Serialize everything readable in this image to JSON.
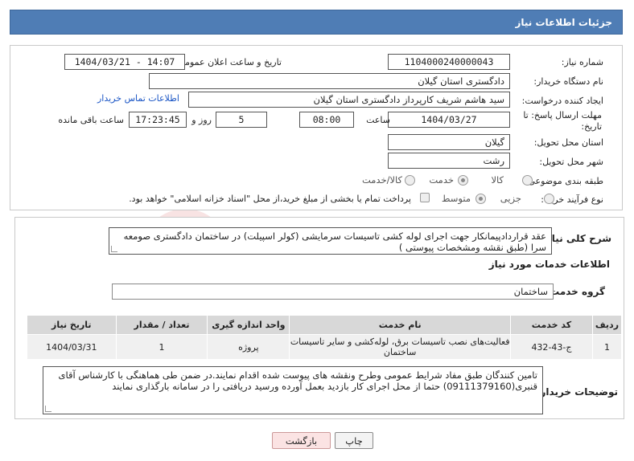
{
  "header": {
    "title": "جزئیات اطلاعات نیاز"
  },
  "form": {
    "need_number_label": "شماره نیاز:",
    "need_number": "1104000240000043",
    "announce_label": "تاریخ و ساعت اعلان عمومی:",
    "announce_value": "1404/03/21 - 14:07",
    "buyer_org_label": "نام دستگاه خریدار:",
    "buyer_org": "دادگستری استان گیلان",
    "requester_label": "ایجاد کننده درخواست:",
    "requester": "سید هاشم شریف کارپرداز دادگستری استان گیلان",
    "contact_link": "اطلاعات تماس خریدار",
    "deadline_label": "مهلت ارسال پاسخ: تا تاریخ:",
    "deadline_date": "1404/03/27",
    "time_label": "ساعت",
    "deadline_time": "08:00",
    "days_value": "5",
    "days_label": "روز و",
    "remaining_time": "17:23:45",
    "remaining_label": "ساعت باقی مانده",
    "province_label": "استان محل تحویل:",
    "province": "گیلان",
    "city_label": "شهر محل تحویل:",
    "city": "رشت",
    "category_label": "طبقه بندی موضوعی:",
    "category_options": [
      "کالا",
      "خدمت",
      "کالا/خدمت"
    ],
    "category_selected": "خدمت",
    "process_label": "نوع فرآیند خرید :",
    "process_options": [
      "جزیی",
      "متوسط"
    ],
    "process_selected": "متوسط",
    "payment_note": "پرداخت تمام یا بخشی از مبلغ خرید،از محل \"اسناد خزانه اسلامی\" خواهد بود."
  },
  "summary": {
    "label": "شرح کلی نیاز:",
    "text": "عقد قراردادپیمانکار جهت اجرای لوله کشی تاسیسات سرمایشی (کولر اسپیلت) در ساختمان دادگستری صومعه سرا (طبق نقشه ومشخصات پیوستی )"
  },
  "services": {
    "title": "اطلاعات خدمات مورد نیاز",
    "group_label": "گروه خدمت:",
    "group_value": "ساختمان",
    "columns": [
      "ردیف",
      "کد خدمت",
      "نام خدمت",
      "واحد اندازه گیری",
      "تعداد / مقدار",
      "تاریخ نیاز"
    ],
    "rows": [
      [
        "1",
        "ج-43-432",
        "فعالیت‌های نصب تاسیسات برق، لوله‌کشی و سایر تاسیسات ساختمان",
        "پروژه",
        "1",
        "1404/03/31"
      ]
    ]
  },
  "buyer_notes": {
    "label": "توضیحات خریدار:",
    "text": "تامین کنندگان طبق  مفاد شرایط عمومی وطرح ونقشه های پیوست شده اقدام نمایند.در ضمن طی هماهنگی با کارشناس آقای قنبری(09111379160) حتما از محل اجرای کار بازدید بعمل آورده ورسید دریافتی را در سامانه بارگذاری نمایند"
  },
  "buttons": {
    "print": "چاپ",
    "back": "بازگشت"
  },
  "watermark": {
    "text": "AriaTender.net"
  },
  "colors": {
    "header_bg": "#4f7db5",
    "link": "#1a55c5",
    "back_button_bg": "#fbe3e3"
  }
}
